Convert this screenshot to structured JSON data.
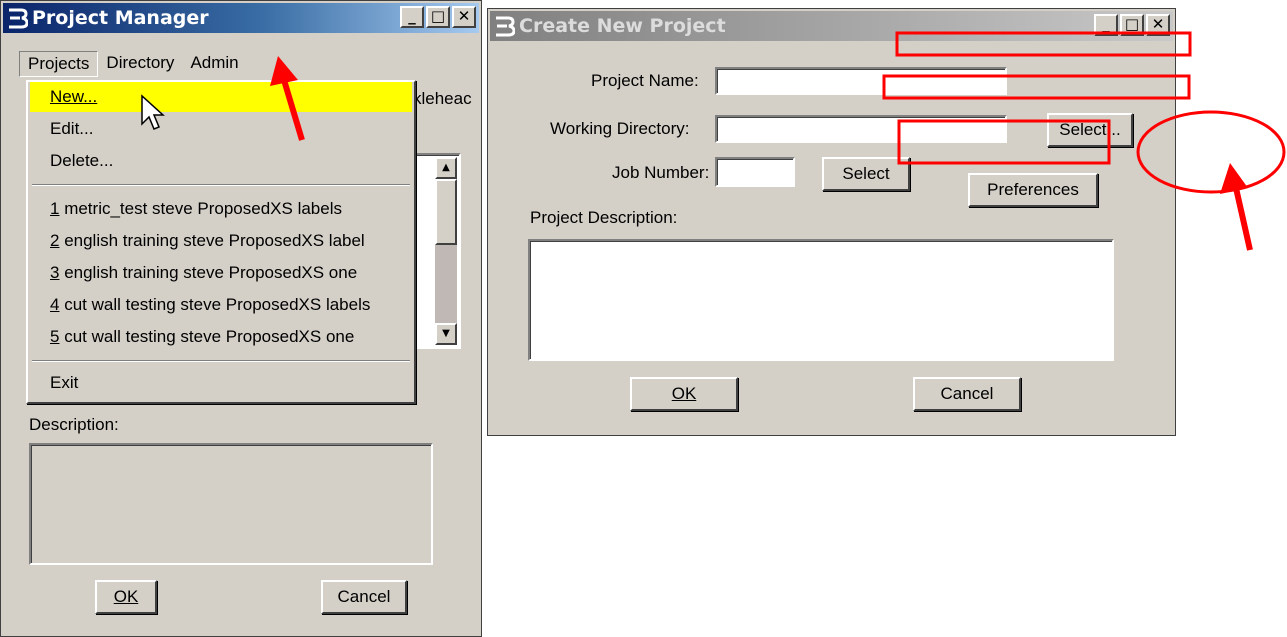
{
  "project_manager": {
    "title": "Project Manager",
    "menubar": {
      "projects": "Projects",
      "directory": "Directory",
      "admin": "Admin"
    },
    "behind_text": "kleheac",
    "description_label": "Description:",
    "ok_label": "OK",
    "cancel_label": "Cancel"
  },
  "projects_menu": {
    "new": "New...",
    "edit": "Edit...",
    "delete": "Delete...",
    "recent": [
      {
        "num": "1",
        "label": " metric_test steve ProposedXS labels"
      },
      {
        "num": "2",
        "label": " english training steve ProposedXS label"
      },
      {
        "num": "3",
        "label": " english training steve ProposedXS one"
      },
      {
        "num": "4",
        "label": " cut wall testing steve ProposedXS labels"
      },
      {
        "num": "5",
        "label": " cut wall testing steve ProposedXS one"
      }
    ],
    "exit": "Exit"
  },
  "create_project": {
    "title": "Create New Project",
    "project_name_label": "Project Name:",
    "project_name_value": "",
    "working_directory_label": "Working Directory:",
    "working_directory_value": "",
    "working_dir_select_label": "Select...",
    "job_number_label": "Job Number:",
    "job_number_value": "",
    "job_select_label": "Select",
    "preferences_label": "Preferences",
    "description_label": "Project Description:",
    "description_value": "",
    "ok_label": "OK",
    "cancel_label": "Cancel"
  },
  "colors": {
    "annotation": "#ff0000",
    "highlight": "#ffff00",
    "active_title": "#0a246a",
    "window_face": "#d4d0c8"
  },
  "icons": {
    "app": "bentley-b-icon",
    "cursor": "arrow-cursor-icon"
  }
}
